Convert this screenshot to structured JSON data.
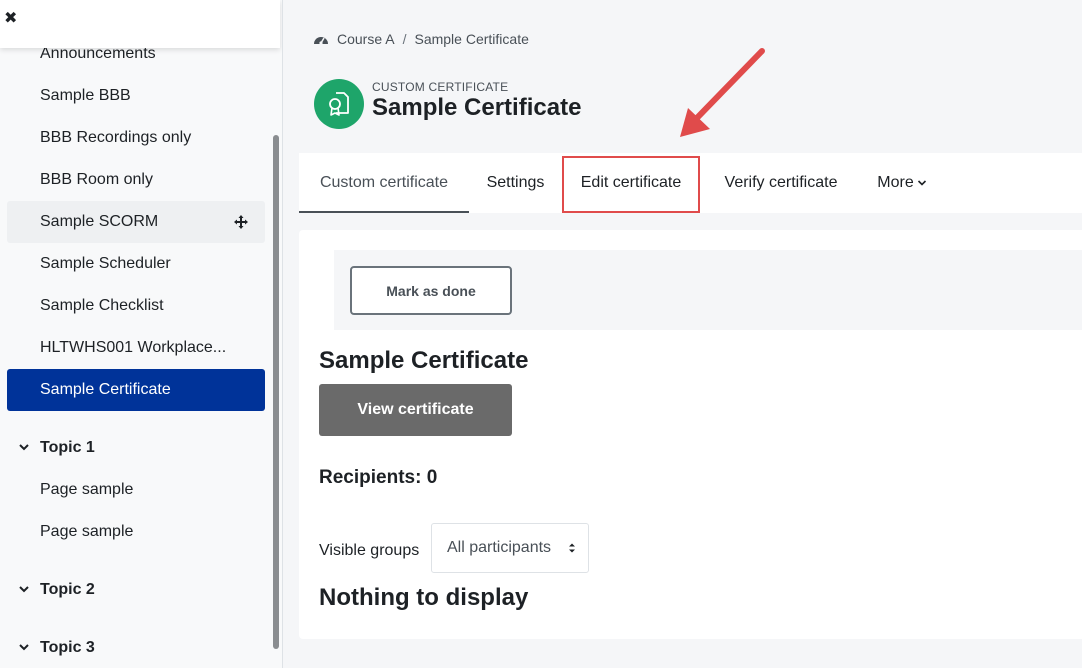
{
  "sidebar": {
    "close_icon": "close-icon",
    "items": [
      {
        "label": "Announcements"
      },
      {
        "label": "Sample BBB"
      },
      {
        "label": "BBB Recordings only"
      },
      {
        "label": "BBB Room only"
      },
      {
        "label": "Sample SCORM"
      },
      {
        "label": "Sample Scheduler"
      },
      {
        "label": "Sample Checklist"
      },
      {
        "label": "HLTWHS001 Workplace..."
      },
      {
        "label": "Sample Certificate"
      }
    ],
    "sections": [
      {
        "title": "Topic 1",
        "items": [
          {
            "label": "Page sample"
          },
          {
            "label": "Page sample"
          }
        ]
      },
      {
        "title": "Topic 2"
      },
      {
        "title": "Topic 3"
      }
    ],
    "active_color": "#003399"
  },
  "breadcrumb": {
    "course": "Course A",
    "separator": "/",
    "current": "Sample Certificate"
  },
  "module": {
    "type_label": "CUSTOM CERTIFICATE",
    "title": "Sample Certificate",
    "icon": "certificate-icon",
    "icon_color": "#1ea56a"
  },
  "tabs": [
    {
      "label": "Custom certificate"
    },
    {
      "label": "Settings"
    },
    {
      "label": "Edit certificate"
    },
    {
      "label": "Verify certificate"
    },
    {
      "label": "More"
    }
  ],
  "content": {
    "mark_done": "Mark as done",
    "heading": "Sample Certificate",
    "view_button": "View certificate",
    "recipients": "Recipients: 0",
    "visible_groups_label": "Visible groups",
    "visible_groups_value": "All participants",
    "empty_message": "Nothing to display"
  },
  "annotation": {
    "arrow_color": "#e04b4b",
    "highlight_color": "#e04b4b"
  }
}
